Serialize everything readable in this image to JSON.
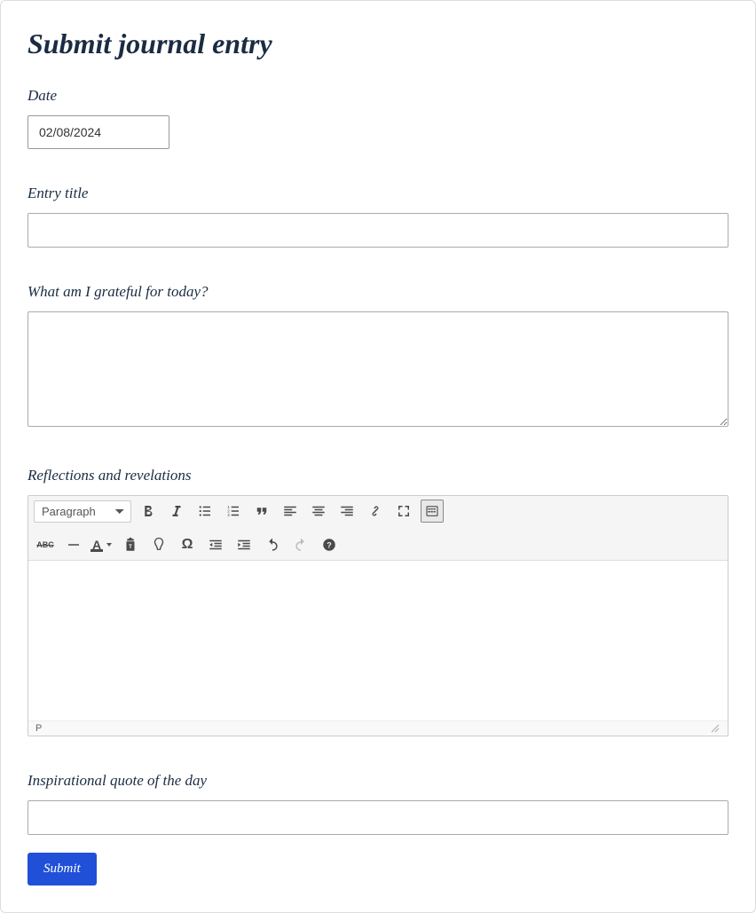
{
  "page_title": "Submit journal entry",
  "fields": {
    "date": {
      "label": "Date",
      "value": "02/08/2024"
    },
    "title": {
      "label": "Entry title",
      "value": ""
    },
    "grateful": {
      "label": "What am I grateful for today?",
      "value": ""
    },
    "reflections": {
      "label": "Reflections and revelations",
      "value": ""
    },
    "quote": {
      "label": "Inspirational quote of the day",
      "value": ""
    }
  },
  "editor": {
    "format_selector": "Paragraph",
    "status_path": "P"
  },
  "submit_label": "Submit"
}
